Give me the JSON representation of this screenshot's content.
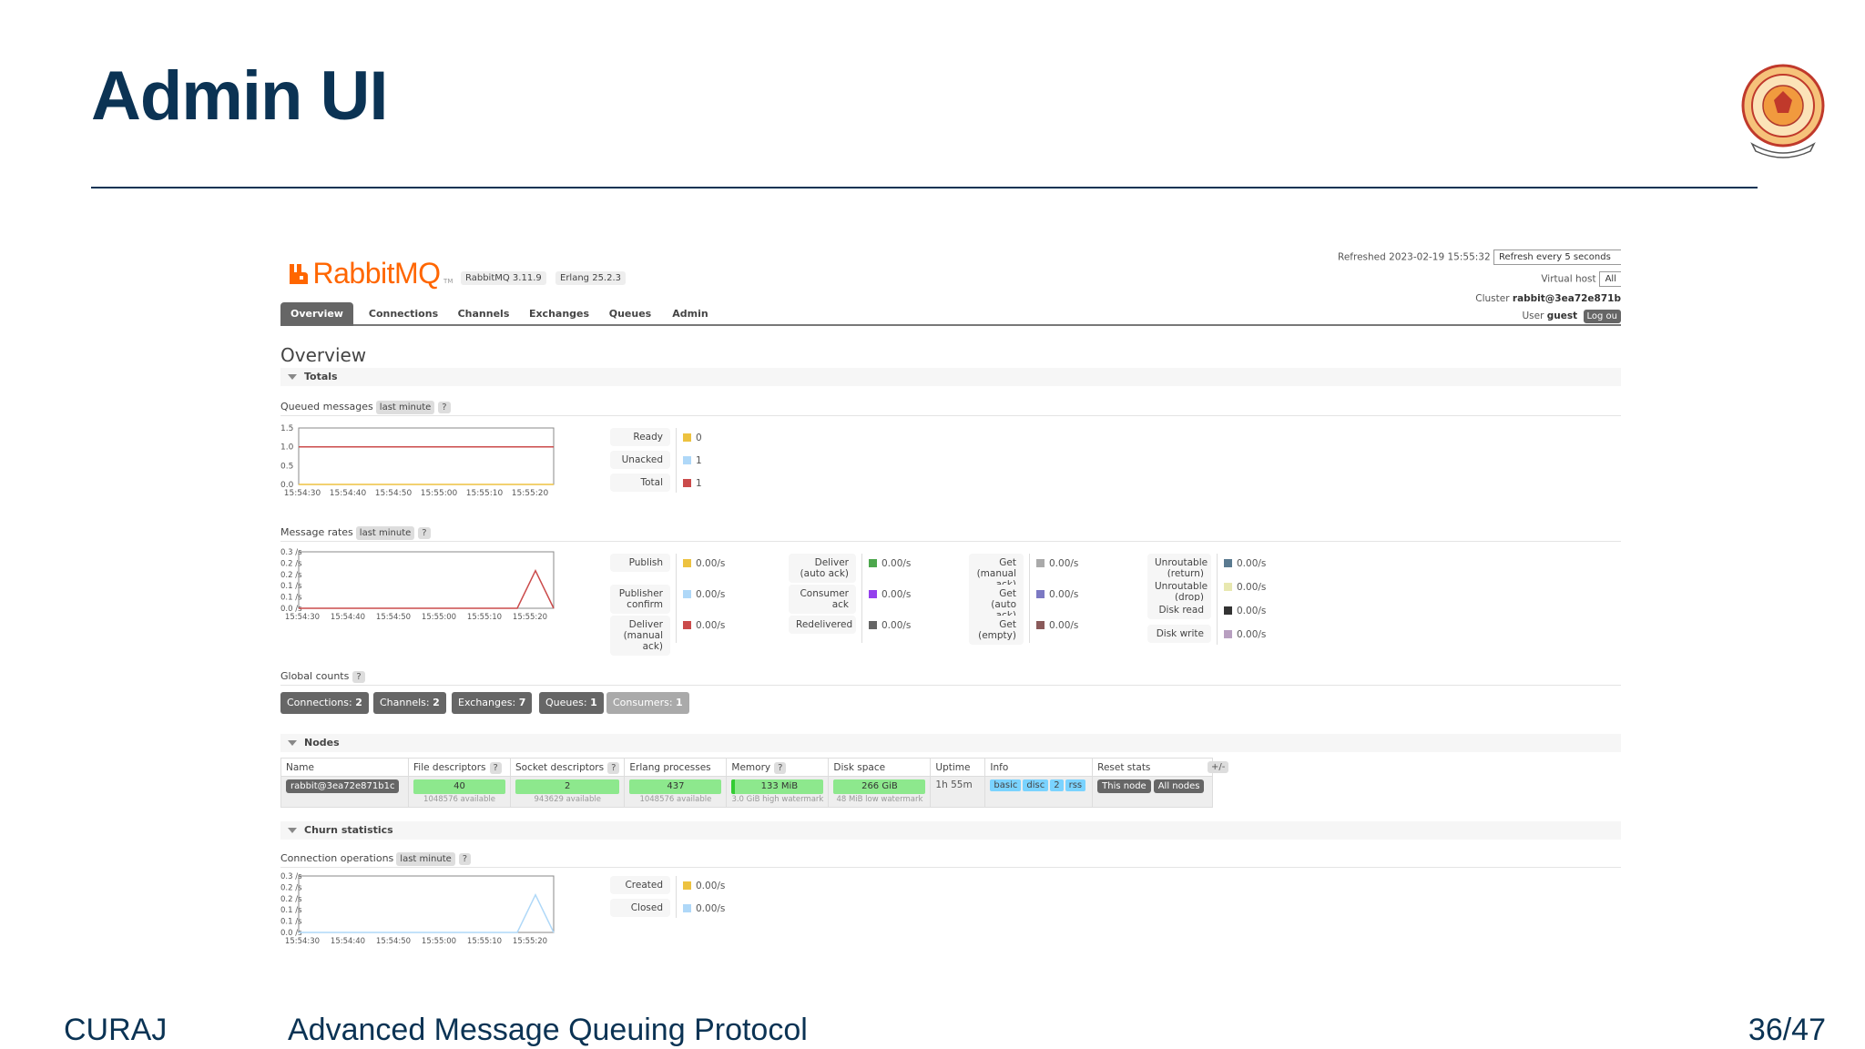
{
  "slide": {
    "title": "Admin UI",
    "footer_left": "CURAJ",
    "footer_center": "Advanced Message Queuing Protocol",
    "footer_right": "36/47"
  },
  "header": {
    "brand": "RabbitMQ",
    "tm": "TM",
    "version": "RabbitMQ 3.11.9",
    "erlang": "Erlang 25.2.3",
    "refreshed_label": "Refreshed 2023-02-19 15:55:32",
    "refresh_select": "Refresh every 5 seconds",
    "vhost_label": "Virtual host",
    "vhost_value": "All",
    "cluster_label": "Cluster",
    "cluster_value": "rabbit@3ea72e871b",
    "user_label": "User",
    "user_value": "guest",
    "logout": "Log ou"
  },
  "tabs": [
    "Overview",
    "Connections",
    "Channels",
    "Exchanges",
    "Queues",
    "Admin"
  ],
  "page_title": "Overview",
  "totals": {
    "heading": "Totals",
    "queued_label": "Queued messages",
    "queued_range": "last minute",
    "help": "?",
    "queued_legend": [
      {
        "label": "Ready",
        "value": "0",
        "color": "#edc240"
      },
      {
        "label": "Unacked",
        "value": "1",
        "color": "#afd8f8"
      },
      {
        "label": "Total",
        "value": "1",
        "color": "#cb4b4b"
      }
    ],
    "rates_label": "Message rates",
    "rates_range": "last minute",
    "rates_col1": [
      {
        "label": "Publish",
        "value": "0.00/s",
        "color": "#edc240"
      },
      {
        "label": "Publisher confirm",
        "value": "0.00/s",
        "color": "#afd8f8"
      },
      {
        "label": "Deliver (manual ack)",
        "value": "0.00/s",
        "color": "#cb4b4b"
      }
    ],
    "rates_col2": [
      {
        "label": "Deliver (auto ack)",
        "value": "0.00/s",
        "color": "#4da74d"
      },
      {
        "label": "Consumer ack",
        "value": "0.00/s",
        "color": "#9440ed"
      },
      {
        "label": "Redelivered",
        "value": "0.00/s",
        "color": "#666666"
      }
    ],
    "rates_col3": [
      {
        "label": "Get (manual ack)",
        "value": "0.00/s",
        "color": "#aaaaaa"
      },
      {
        "label": "Get (auto ack)",
        "value": "0.00/s",
        "color": "#7c79c3"
      },
      {
        "label": "Get (empty)",
        "value": "0.00/s",
        "color": "#8a5a5a"
      }
    ],
    "rates_col4": [
      {
        "label": "Unroutable (return)",
        "value": "0.00/s",
        "color": "#5a7a90"
      },
      {
        "label": "Unroutable (drop)",
        "value": "0.00/s",
        "color": "#e8e8b0"
      },
      {
        "label": "Disk read",
        "value": "0.00/s",
        "color": "#333333"
      },
      {
        "label": "Disk write",
        "value": "0.00/s",
        "color": "#b89fc0"
      }
    ],
    "global_label": "Global counts",
    "global_counts": [
      {
        "label": "Connections:",
        "value": "2"
      },
      {
        "label": "Channels:",
        "value": "2"
      },
      {
        "label": "Exchanges:",
        "value": "7"
      },
      {
        "label": "Queues:",
        "value": "1"
      },
      {
        "label": "Consumers:",
        "value": "1"
      }
    ]
  },
  "nodes": {
    "heading": "Nodes",
    "plusminus": "+/-",
    "columns": [
      "Name",
      "File descriptors",
      "Socket descriptors",
      "Erlang processes",
      "Memory",
      "Disk space",
      "Uptime",
      "Info",
      "Reset stats"
    ],
    "row": {
      "name": "rabbit@3ea72e871b1c",
      "fd": "40",
      "fd_note": "1048576 available",
      "sd": "2",
      "sd_note": "943629 available",
      "ep": "437",
      "ep_note": "1048576 available",
      "mem": "133 MiB",
      "mem_note": "3.0 GiB high watermark",
      "disk": "266 GiB",
      "disk_note": "48 MiB low watermark",
      "uptime": "1h 55m",
      "info_tags": [
        "basic",
        "disc",
        "2",
        "rss"
      ],
      "reset_this": "This node",
      "reset_all": "All nodes"
    }
  },
  "churn": {
    "heading": "Churn statistics",
    "conn_label": "Connection operations",
    "conn_range": "last minute",
    "legend": [
      {
        "label": "Created",
        "value": "0.00/s",
        "color": "#edc240"
      },
      {
        "label": "Closed",
        "value": "0.00/s",
        "color": "#afd8f8"
      }
    ]
  },
  "chart_data": [
    {
      "type": "line",
      "x": [
        "15:54:30",
        "15:54:40",
        "15:54:50",
        "15:55:00",
        "15:55:10",
        "15:55:20"
      ],
      "yticks": [
        "0.0",
        "0.5",
        "1.0",
        "1.5"
      ],
      "ylim": [
        0,
        1.5
      ],
      "series": [
        {
          "name": "Ready",
          "color": "#edc240",
          "values": [
            0,
            0,
            0,
            0,
            0,
            0,
            0
          ]
        },
        {
          "name": "Unacked",
          "color": "#afd8f8",
          "values": [
            1,
            1,
            1,
            1,
            1,
            1,
            1
          ]
        },
        {
          "name": "Total",
          "color": "#cb4b4b",
          "values": [
            1,
            1,
            1,
            1,
            1,
            1,
            1
          ]
        }
      ]
    },
    {
      "type": "line",
      "x": [
        "15:54:30",
        "15:54:40",
        "15:54:50",
        "15:55:00",
        "15:55:10",
        "15:55:20"
      ],
      "yticks": [
        "0.0 /s",
        "0.1 /s",
        "0.1 /s",
        "0.2 /s",
        "0.2 /s",
        "0.3 /s"
      ],
      "ylim": [
        0,
        0.3
      ],
      "series": [
        {
          "name": "Deliver (manual ack)",
          "color": "#cb4b4b",
          "values": [
            0,
            0,
            0,
            0,
            0,
            0,
            0,
            0,
            0,
            0,
            0,
            0,
            0,
            0.2,
            0
          ]
        }
      ]
    },
    {
      "type": "line",
      "x": [
        "15:54:30",
        "15:54:40",
        "15:54:50",
        "15:55:00",
        "15:55:10",
        "15:55:20"
      ],
      "yticks": [
        "0.0 /s",
        "0.1 /s",
        "0.1 /s",
        "0.2 /s",
        "0.2 /s",
        "0.3 /s"
      ],
      "ylim": [
        0,
        0.3
      ],
      "series": [
        {
          "name": "Closed",
          "color": "#afd8f8",
          "values": [
            0,
            0,
            0,
            0,
            0,
            0,
            0,
            0,
            0,
            0,
            0,
            0,
            0,
            0.2,
            0
          ]
        }
      ]
    }
  ]
}
